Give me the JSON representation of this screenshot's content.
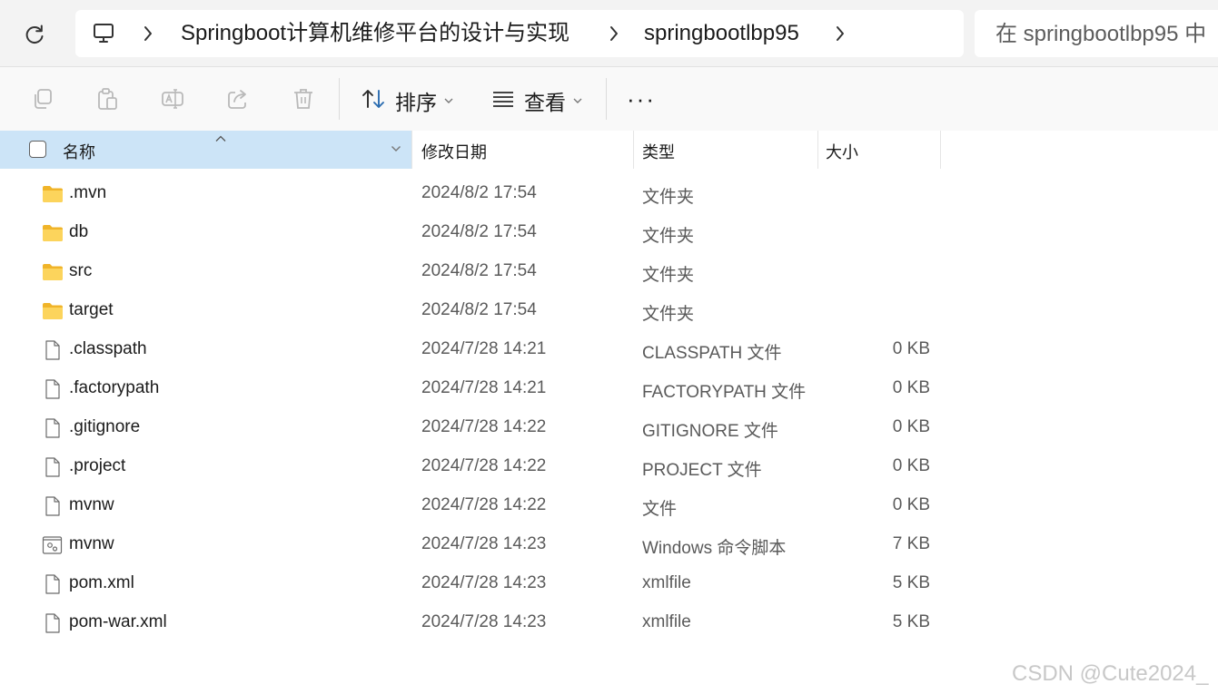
{
  "address_bar": {
    "breadcrumbs": [
      "Springboot计算机维修平台的设计与实现",
      "springbootlbp95"
    ],
    "search_placeholder": "在 springbootlbp95 中"
  },
  "toolbar": {
    "sort_label": "排序",
    "view_label": "查看",
    "more_label": "···"
  },
  "columns": {
    "name": "名称",
    "modified": "修改日期",
    "type": "类型",
    "size": "大小"
  },
  "files": [
    {
      "name": ".mvn",
      "modified": "2024/8/2 17:54",
      "type": "文件夹",
      "size": "",
      "icon": "folder-icon"
    },
    {
      "name": "db",
      "modified": "2024/8/2 17:54",
      "type": "文件夹",
      "size": "",
      "icon": "folder-icon"
    },
    {
      "name": "src",
      "modified": "2024/8/2 17:54",
      "type": "文件夹",
      "size": "",
      "icon": "folder-icon"
    },
    {
      "name": "target",
      "modified": "2024/8/2 17:54",
      "type": "文件夹",
      "size": "",
      "icon": "folder-icon"
    },
    {
      "name": ".classpath",
      "modified": "2024/7/28 14:21",
      "type": "CLASSPATH 文件",
      "size": "0 KB",
      "icon": "file-icon"
    },
    {
      "name": ".factorypath",
      "modified": "2024/7/28 14:21",
      "type": "FACTORYPATH 文件",
      "size": "0 KB",
      "icon": "file-icon"
    },
    {
      "name": ".gitignore",
      "modified": "2024/7/28 14:22",
      "type": "GITIGNORE 文件",
      "size": "0 KB",
      "icon": "file-icon"
    },
    {
      "name": ".project",
      "modified": "2024/7/28 14:22",
      "type": "PROJECT 文件",
      "size": "0 KB",
      "icon": "file-icon"
    },
    {
      "name": "mvnw",
      "modified": "2024/7/28 14:22",
      "type": "文件",
      "size": "0 KB",
      "icon": "file-icon"
    },
    {
      "name": "mvnw",
      "modified": "2024/7/28 14:23",
      "type": "Windows 命令脚本",
      "size": "7 KB",
      "icon": "script-icon"
    },
    {
      "name": "pom.xml",
      "modified": "2024/7/28 14:23",
      "type": "xmlfile",
      "size": "5 KB",
      "icon": "file-icon"
    },
    {
      "name": "pom-war.xml",
      "modified": "2024/7/28 14:23",
      "type": "xmlfile",
      "size": "5 KB",
      "icon": "file-icon"
    }
  ],
  "watermark": "CSDN @Cute2024_",
  "colors": {
    "header_selected": "#cce4f7",
    "folder_yellow": "#f8c73a",
    "address_bg": "#f3f3f3"
  }
}
